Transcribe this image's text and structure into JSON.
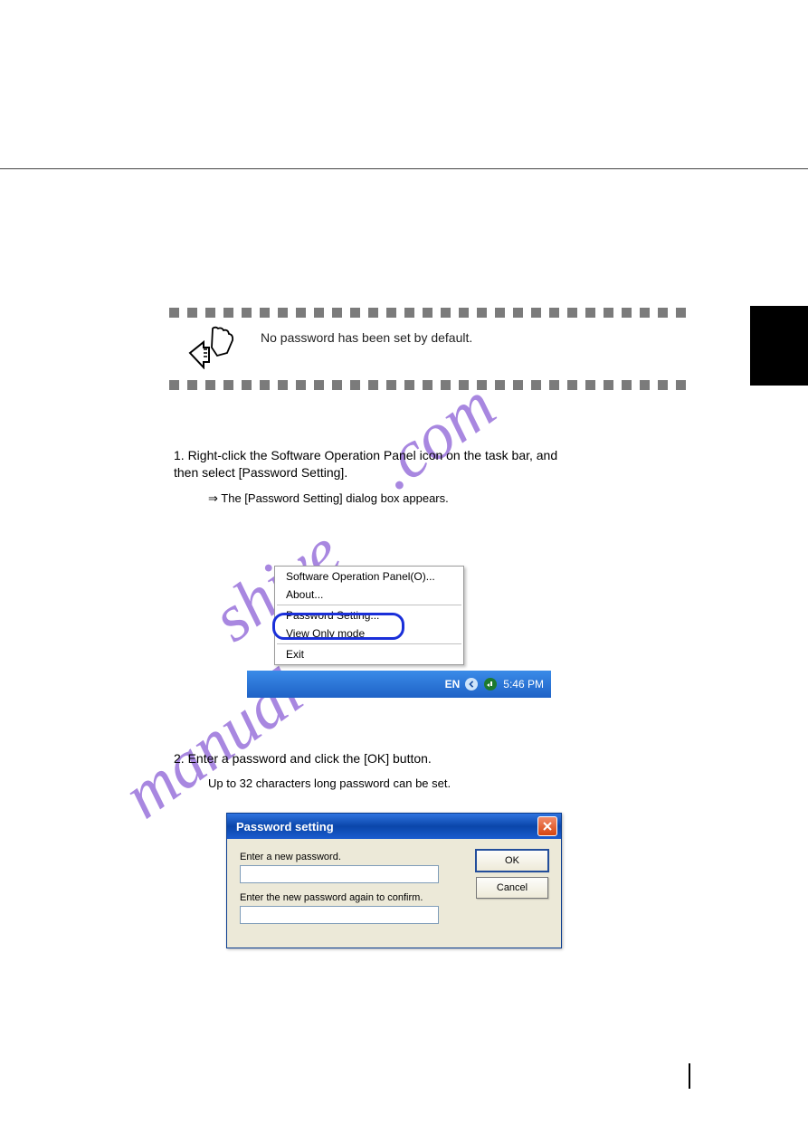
{
  "note": "No password has been set by default.",
  "watermark1": ".com",
  "watermark2": "shive",
  "watermark3": "manual",
  "step1_line1": "1.   Right-click the Software Operation Panel icon on the task bar, and",
  "step1_line2": "     then select [Password Setting].",
  "step1_result": "⇒ The [Password Setting] dialog box appears.",
  "step2": "2.   Enter a password and click the [OK] button.",
  "step2_note": "Up to 32 characters long password can be set.",
  "context_menu": {
    "items": [
      "Software Operation Panel(O)...",
      "About...",
      "Password Setting...",
      "View Only mode",
      "Exit"
    ]
  },
  "tray": {
    "lang": "EN",
    "clock": "5:46 PM"
  },
  "dialog": {
    "title": "Password setting",
    "label1": "Enter a new password.",
    "label2": "Enter the new password again to confirm.",
    "ok": "OK",
    "cancel": "Cancel"
  }
}
